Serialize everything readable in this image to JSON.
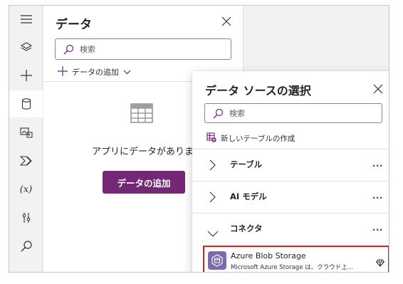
{
  "rail": {
    "items": [
      {
        "name": "hamburger-menu-icon"
      },
      {
        "name": "layers-icon"
      },
      {
        "name": "insert-plus-icon"
      },
      {
        "name": "database-icon"
      },
      {
        "name": "media-icon"
      },
      {
        "name": "power-automate-icon"
      },
      {
        "name": "variables-icon"
      },
      {
        "name": "advanced-tools-icon"
      },
      {
        "name": "search-icon"
      }
    ],
    "variables_label": "(x)"
  },
  "data_panel": {
    "title": "データ",
    "search_placeholder": "検索",
    "add_data_label": "データの追加",
    "empty_message": "アプリにデータがありませ",
    "add_data_button": "データの追加"
  },
  "popup": {
    "title": "データ ソースの選択",
    "search_placeholder": "検索",
    "new_table_label": "新しいテーブルの作成",
    "sections": [
      {
        "label": "テーブル",
        "expanded": false,
        "more": "..."
      },
      {
        "label": "AI モデル",
        "expanded": false,
        "more": "..."
      },
      {
        "label": "コネクタ",
        "expanded": true,
        "more": "..."
      }
    ],
    "connector": {
      "name": "Azure Blob Storage",
      "description": "Microsoft Azure Storage は、クラウド上...",
      "icon": "azure-blob-storage-icon",
      "badge_icon": "premium-diamond-icon"
    }
  },
  "colors": {
    "accent": "#742774",
    "highlight_border": "#d6202a",
    "connector_logo": "#7e6ba9"
  }
}
